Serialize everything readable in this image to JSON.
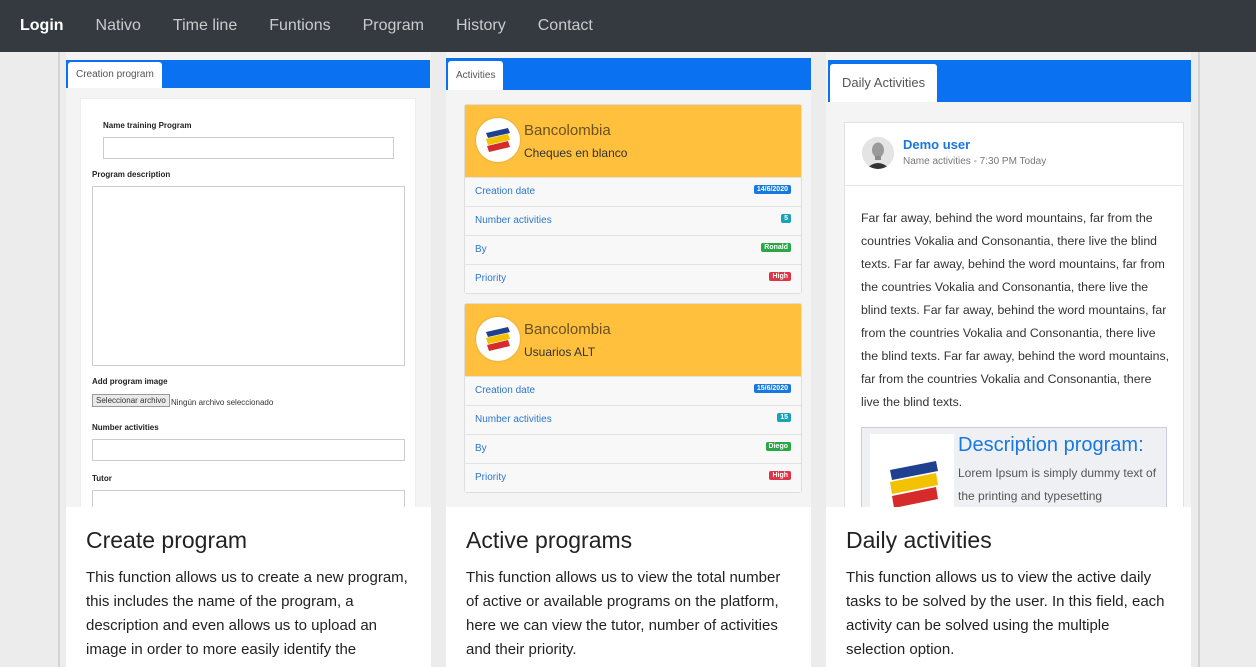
{
  "nav": {
    "items": [
      "Login",
      "Nativo",
      "Time line",
      "Funtions",
      "Program",
      "History",
      "Contact"
    ]
  },
  "create": {
    "tab": "Creation program",
    "name_label": "Name training Program",
    "desc_label": "Program description",
    "image_label": "Add program image",
    "file_button": "Seleccionar archivo",
    "file_text": "Ningún archivo seleccionado",
    "activities_label": "Number activities",
    "tutor_label": "Tutor",
    "caption_title": "Create program",
    "caption_text": "This function allows us to create a new program, this includes the name of the program, a description and even allows us to upload an image in order to more easily identify the"
  },
  "active": {
    "tab": "Activities",
    "cards": [
      {
        "bank": "Bancolombia",
        "subtitle": "Cheques en blanco",
        "rows": [
          {
            "label": "Creation date",
            "badge": "14/6/2020",
            "color": "#1978e0"
          },
          {
            "label": "Number activities",
            "badge": "5",
            "color": "#18a2b8"
          },
          {
            "label": "By",
            "badge": "Ronald",
            "color": "#28a745"
          },
          {
            "label": "Priority",
            "badge": "High",
            "color": "#dc3545"
          }
        ]
      },
      {
        "bank": "Bancolombia",
        "subtitle": "Usuarios ALT",
        "rows": [
          {
            "label": "Creation date",
            "badge": "15/6/2020",
            "color": "#1978e0"
          },
          {
            "label": "Number activities",
            "badge": "15",
            "color": "#18a2b8"
          },
          {
            "label": "By",
            "badge": "Diego",
            "color": "#28a745"
          },
          {
            "label": "Priority",
            "badge": "High",
            "color": "#dc3545"
          }
        ]
      }
    ],
    "caption_title": "Active programs",
    "caption_text": "This function allows us to view the total number of active or available programs on the platform, here we can view the tutor, number of activities and their priority."
  },
  "daily": {
    "tab": "Daily Activities",
    "user": "Demo user",
    "meta": "Name activities - 7:30 PM Today",
    "body": "Far far away, behind the word mountains, far from the countries Vokalia and Consonantia, there live the blind texts. Far far away, behind the word mountains, far from the countries Vokalia and Consonantia, there live the blind texts. Far far away, behind the word mountains, far from the countries Vokalia and Consonantia, there live the blind texts. Far far away, behind the word mountains, far from the countries Vokalia and Consonantia, there live the blind texts.",
    "desc_title": "Description program:",
    "desc_body": "Lorem Ipsum is simply dummy text of the printing and typesetting",
    "caption_title": "Daily activities",
    "caption_text": "This function allows us to view the active daily tasks to be solved by the user. In this field, each activity can be solved using the multiple selection option."
  },
  "colors": {
    "navbar": "#353a40",
    "tabbar": "#0a72f0",
    "card_header": "#ffc03d",
    "link": "#1978e0"
  }
}
